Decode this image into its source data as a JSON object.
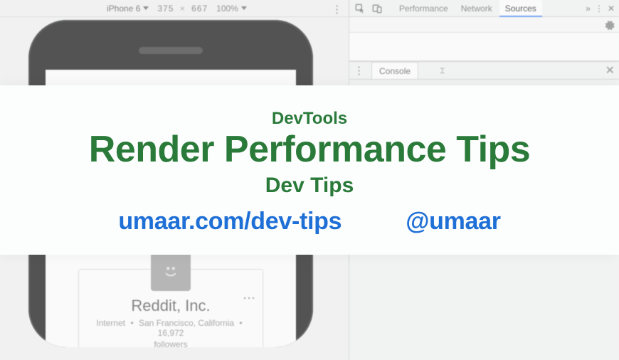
{
  "device_toolbar": {
    "device_name": "iPhone 6",
    "width": "375",
    "height": "667",
    "zoom": "100%"
  },
  "devtools": {
    "tabs": {
      "performance": "Performance",
      "network": "Network",
      "sources": "Sources"
    },
    "drawer_tab": "Console"
  },
  "card": {
    "title": "Reddit, Inc.",
    "category": "Internet",
    "location": "San Francisco, California",
    "count": "16,972",
    "followers_label": "followers"
  },
  "overlay": {
    "line1": "DevTools",
    "title": "Render Performance Tips",
    "line3": "Dev Tips",
    "link": "umaar.com/dev-tips",
    "handle": "@umaar"
  }
}
